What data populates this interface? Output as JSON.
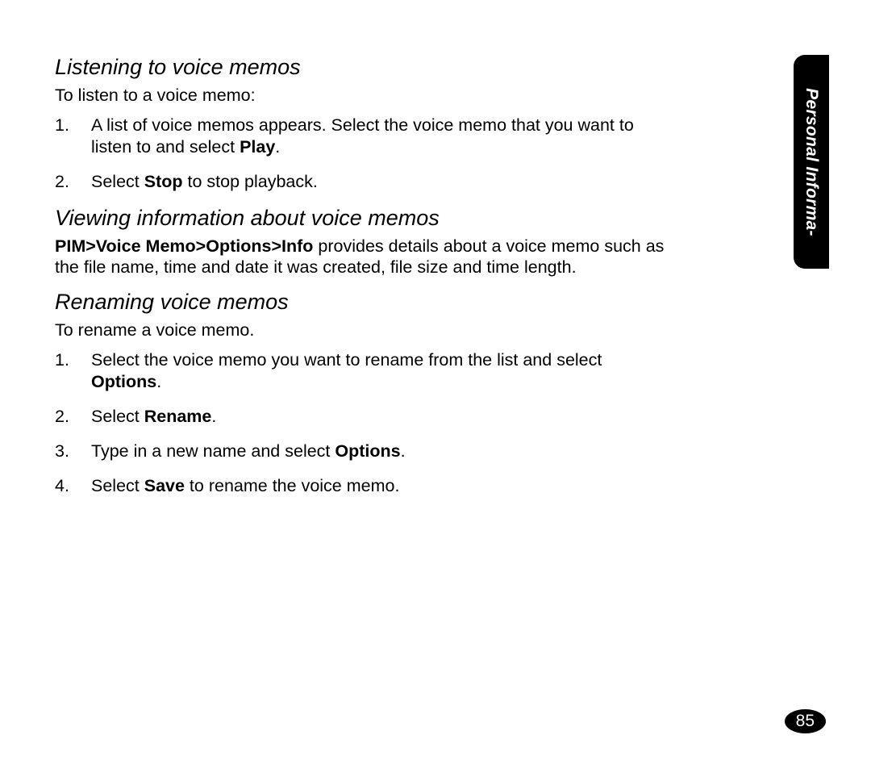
{
  "sideTab": "Personal Informa-",
  "pageNumber": "85",
  "section1": {
    "heading": "Listening to voice memos",
    "intro": "To listen to a voice memo:",
    "step1_a": "A list of voice memos appears. Select the voice memo that you want to listen to and select ",
    "step1_b": "Play",
    "step1_c": ".",
    "step2_a": "Select ",
    "step2_b": "Stop",
    "step2_c": " to stop playback."
  },
  "section2": {
    "heading": "Viewing information about voice memos",
    "para_a": "PIM",
    "para_gt": ">",
    "para_b": "Voice Memo",
    "para_c": "Options",
    "para_d": "Info",
    "para_e": " provides details about a voice memo such as the file name, time and date it was created, file size and time length."
  },
  "section3": {
    "heading": "Renaming voice memos",
    "intro": "To rename a voice memo.",
    "step1_a": "Select the voice memo you want to rename from the list and select ",
    "step1_b": "Options",
    "step1_c": ".",
    "step2_a": "Select ",
    "step2_b": "Rename",
    "step2_c": ".",
    "step3_a": "Type in a new name and select ",
    "step3_b": "Options",
    "step3_c": ".",
    "step4_a": "Select ",
    "step4_b": "Save",
    "step4_c": " to rename the voice memo."
  }
}
